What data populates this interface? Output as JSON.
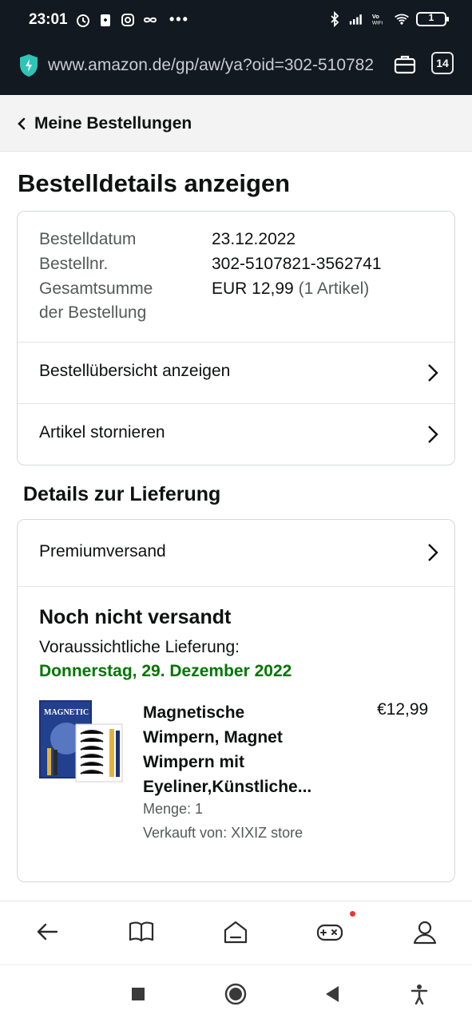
{
  "status_bar": {
    "time": "23:01",
    "battery": "1",
    "icons_left": [
      "alarm-icon",
      "sim-icon",
      "instagram-icon",
      "infinity-icon"
    ],
    "icons_right": [
      "bluetooth-icon",
      "signal-icon",
      "vowifi-icon",
      "wifi-icon"
    ]
  },
  "browser": {
    "url": "www.amazon.de/gp/aw/ya?oid=302-510782",
    "tab_count": "14"
  },
  "header": {
    "back_label": "Meine Bestellungen"
  },
  "page": {
    "title": "Bestelldetails anzeigen"
  },
  "order_summary": {
    "date_label": "Bestelldatum",
    "date_value": "23.12.2022",
    "number_label": "Bestellnr.",
    "number_value": "302-5107821-3562741",
    "total_label_1": "Gesamtsumme",
    "total_label_2": "der Bestellung",
    "total_value": "EUR 12,99",
    "total_items": "(1 Artikel)"
  },
  "order_links": {
    "overview": "Bestellübersicht anzeigen",
    "cancel": "Artikel stornieren"
  },
  "delivery": {
    "section_title": "Details zur Lieferung",
    "shipping_method": "Premiumversand",
    "status": "Noch nicht versandt",
    "estimated_label": "Voraussichtliche Lieferung:",
    "estimated_date": "Donnerstag, 29. Dezember 2022"
  },
  "item": {
    "title_line1": "Magnetische",
    "title_line2": "Wimpern, Magnet",
    "title_line3": "Wimpern mit",
    "title_line4": "Eyeliner,Künstliche...",
    "price": "€12,99",
    "quantity": "Menge: 1",
    "seller": "Verkauft von: XIXIZ store",
    "image_text": "MAGNETIC"
  },
  "colors": {
    "dark_bar": "#131921",
    "delivery_green": "#007600",
    "muted_text": "#565959"
  }
}
